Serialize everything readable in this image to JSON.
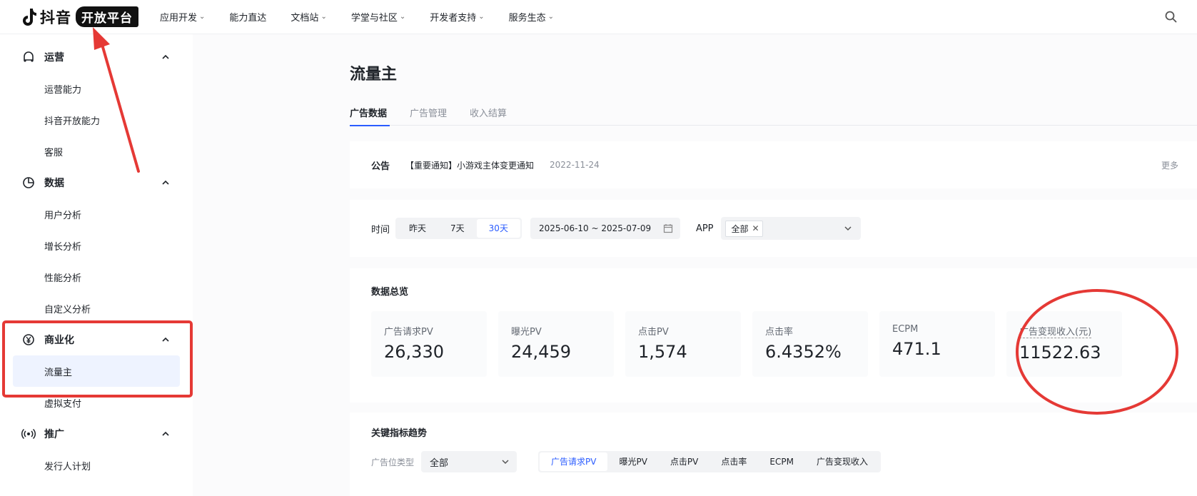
{
  "brand": {
    "name": "抖音",
    "badge": "开放平台"
  },
  "topnav": {
    "items": [
      {
        "label": "应用开发",
        "has_menu": true
      },
      {
        "label": "能力直达",
        "has_menu": false
      },
      {
        "label": "文档站",
        "has_menu": true
      },
      {
        "label": "学堂与社区",
        "has_menu": true
      },
      {
        "label": "开发者支持",
        "has_menu": true
      },
      {
        "label": "服务生态",
        "has_menu": true
      }
    ]
  },
  "sidebar": {
    "groups": [
      {
        "title": "运营",
        "icon": "operation-icon",
        "items": [
          "运营能力",
          "抖音开放能力",
          "客服"
        ]
      },
      {
        "title": "数据",
        "icon": "pie-chart-icon",
        "items": [
          "用户分析",
          "增长分析",
          "性能分析",
          "自定义分析"
        ]
      },
      {
        "title": "商业化",
        "icon": "yuan-icon",
        "items": [
          "流量主",
          "虚拟支付"
        ],
        "active_item": "流量主"
      },
      {
        "title": "推广",
        "icon": "broadcast-icon",
        "items": [
          "发行人计划"
        ]
      }
    ]
  },
  "page": {
    "title": "流量主",
    "tabs": [
      {
        "label": "广告数据",
        "active": true
      },
      {
        "label": "广告管理",
        "active": false
      },
      {
        "label": "收入结算",
        "active": false
      }
    ]
  },
  "notice": {
    "label": "公告",
    "text": "【重要通知】小游戏主体变更通知",
    "date": "2022-11-24",
    "more": "更多"
  },
  "filter": {
    "time_label": "时间",
    "time_options": [
      "昨天",
      "7天",
      "30天"
    ],
    "time_selected": "30天",
    "date_range": "2025-06-10 ~ 2025-07-09",
    "app_label": "APP",
    "app_tag": "全部"
  },
  "overview": {
    "title": "数据总览",
    "cards": [
      {
        "title": "广告请求PV",
        "value": "26,330"
      },
      {
        "title": "曝光PV",
        "value": "24,459"
      },
      {
        "title": "点击PV",
        "value": "1,574"
      },
      {
        "title": "点击率",
        "value": "6.4352%"
      },
      {
        "title": "ECPM",
        "value": "471.1"
      },
      {
        "title": "广告变现收入(元)",
        "value": "11522.63"
      }
    ]
  },
  "trend": {
    "title": "关键指标趋势",
    "slot_type_label": "广告位类型",
    "slot_type_value": "全部",
    "metrics": [
      "广告请求PV",
      "曝光PV",
      "点击PV",
      "点击率",
      "ECPM",
      "广告变现收入"
    ],
    "metric_selected": "广告请求PV"
  },
  "colors": {
    "accent": "#2b5cff",
    "annotation": "#e53935"
  }
}
